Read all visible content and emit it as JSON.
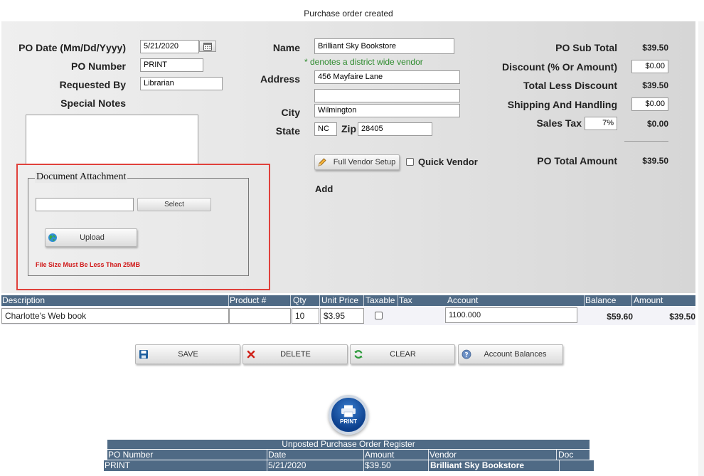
{
  "status_message": "Purchase order created",
  "form": {
    "po_date_label": "PO Date (Mm/Dd/Yyyy)",
    "po_date_value": "5/21/2020",
    "po_number_label": "PO Number",
    "po_number_value": "PRINT",
    "requested_by_label": "Requested By",
    "requested_by_value": "Librarian",
    "special_notes_label": "Special Notes",
    "special_notes_value": ""
  },
  "vendor": {
    "name_label": "Name",
    "name_value": "Brilliant Sky Bookstore",
    "district_note": "* denotes a district wide vendor",
    "address_label": "Address",
    "address1_value": "456 Mayfaire Lane",
    "address2_value": "",
    "city_label": "City",
    "city_value": "Wilmington",
    "state_label": "State",
    "state_value": "NC",
    "zip_label": "Zip",
    "zip_value": "28405",
    "full_setup_label": "Full Vendor Setup",
    "quick_vendor_label": "Quick Vendor",
    "add_label": "Add"
  },
  "totals": {
    "sub_total_label": "PO Sub Total",
    "sub_total_value": "$39.50",
    "discount_label": "Discount (% Or Amount)",
    "discount_value": "$0.00",
    "less_discount_label": "Total Less Discount",
    "less_discount_value": "$39.50",
    "shipping_label": "Shipping And Handling",
    "shipping_value": "$0.00",
    "sales_tax_label": "Sales Tax",
    "sales_tax_rate": "7%",
    "sales_tax_value": "$0.00",
    "po_total_label": "PO Total Amount",
    "po_total_value": "$39.50"
  },
  "attachment": {
    "legend": "Document Attachment",
    "file_value": "",
    "select_label": "Select",
    "upload_label": "Upload",
    "size_warning": "File Size Must Be Less Than 25MB"
  },
  "line_items": {
    "headers": [
      "Description",
      "Product #",
      "Qty",
      "Unit Price",
      "Taxable",
      "Tax",
      "Account",
      "Balance",
      "Amount"
    ],
    "rows": [
      {
        "description": "Charlotte's Web book",
        "product": "",
        "qty": "10",
        "unit_price": "$3.95",
        "account": "1100.000",
        "balance": "$59.60",
        "amount": "$39.50"
      }
    ]
  },
  "actions": {
    "save": "SAVE",
    "delete": "DELETE",
    "clear": "CLEAR",
    "balances": "Account Balances",
    "print": "PRINT"
  },
  "register": {
    "title": "Unposted Purchase Order Register",
    "headers": [
      "PO Number",
      "Date",
      "Amount",
      "Vendor",
      "Doc"
    ],
    "rows": [
      {
        "po_number": "PRINT",
        "date": "5/21/2020",
        "amount": "$39.50",
        "vendor": "Brilliant Sky Bookstore",
        "doc": ""
      }
    ]
  },
  "colors": {
    "grid_header": "#4f6a85",
    "highlight_frame": "#e0413b",
    "warning_text": "#d01818",
    "district_note": "#2e8b2e"
  }
}
